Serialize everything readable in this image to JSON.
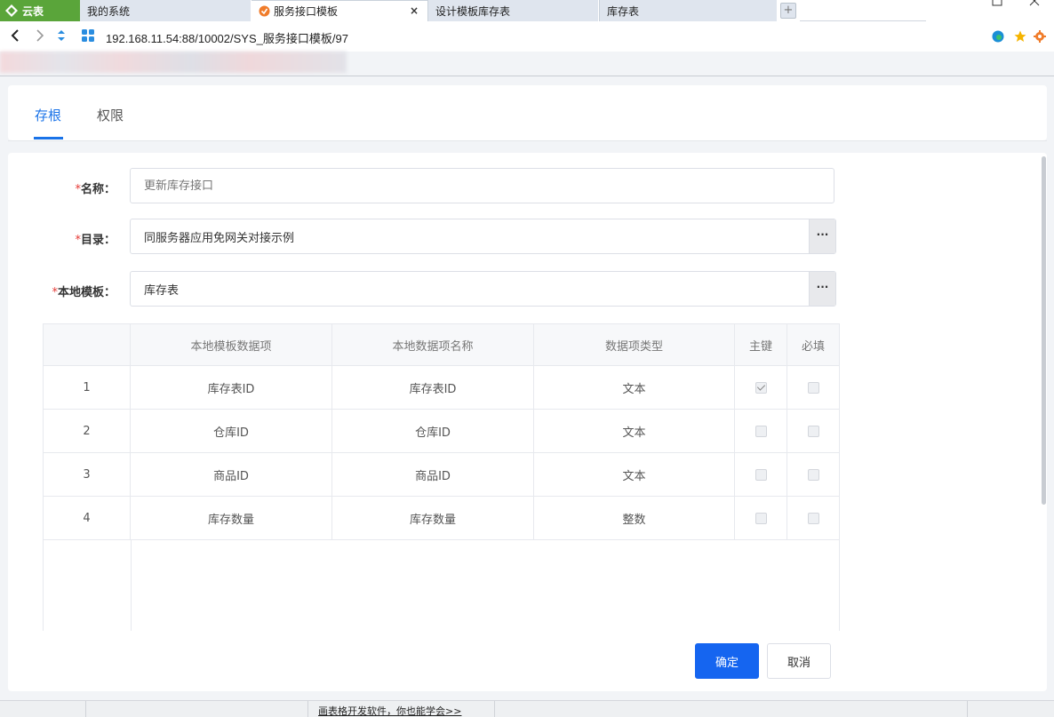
{
  "browser": {
    "brand_tab": "云表",
    "tabs": [
      {
        "label": "我的系统"
      },
      {
        "label": "服务接口模板"
      },
      {
        "label": "设计模板库存表"
      },
      {
        "label": "库存表"
      }
    ],
    "active_tab_close": "×",
    "new_tab": "+",
    "url": "192.168.11.54:88/10002/SYS_服务接口模板/97"
  },
  "page_tabs": [
    {
      "label": "存根",
      "active": true
    },
    {
      "label": "权限",
      "active": false
    }
  ],
  "form": {
    "required_mark": "*",
    "name": {
      "label": "名称：",
      "placeholder": "更新库存接口"
    },
    "directory": {
      "label": "目录：",
      "value": "同服务器应用免网关对接示例",
      "browse": "···"
    },
    "local_template": {
      "label": "本地模板：",
      "value": "库存表",
      "browse": "···"
    }
  },
  "table": {
    "headers": [
      "",
      "本地模板数据项",
      "本地数据项名称",
      "数据项类型",
      "主键",
      "必填"
    ],
    "rows": [
      {
        "index": "1",
        "template_item": "库存表ID",
        "local_name": "库存表ID",
        "type": "文本",
        "primary_key": true,
        "required": false
      },
      {
        "index": "2",
        "template_item": "仓库ID",
        "local_name": "仓库ID",
        "type": "文本",
        "primary_key": false,
        "required": false
      },
      {
        "index": "3",
        "template_item": "商品ID",
        "local_name": "商品ID",
        "type": "文本",
        "primary_key": false,
        "required": false
      },
      {
        "index": "4",
        "template_item": "库存数量",
        "local_name": "库存数量",
        "type": "整数",
        "primary_key": false,
        "required": false
      }
    ]
  },
  "buttons": {
    "confirm": "确定",
    "cancel": "取消"
  },
  "status_bar": {
    "link": "画表格开发软件，你也能学会>>"
  },
  "colors": {
    "brand_green": "#5aa53a",
    "primary_blue": "#1565f0",
    "tab_blue": "#1a73e8",
    "required_red": "#e53935"
  }
}
